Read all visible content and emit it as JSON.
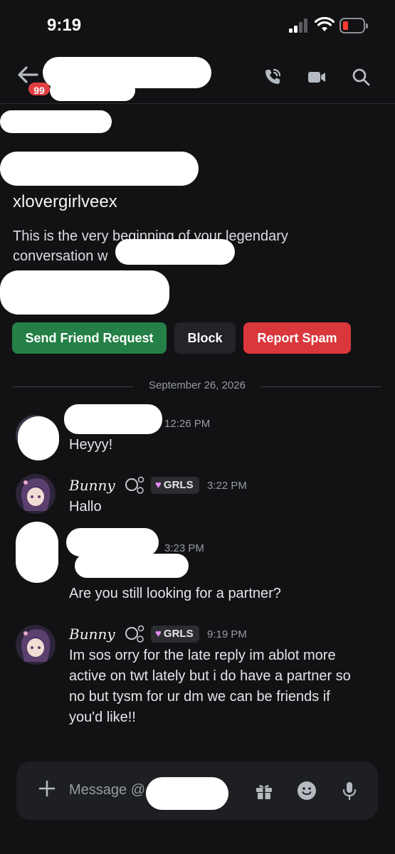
{
  "status_bar": {
    "time": "9:19",
    "battery_color": "#ff3b30"
  },
  "header": {
    "unread_badge": "99",
    "icons": [
      "back-arrow-icon",
      "phone-call-icon",
      "video-camera-icon",
      "search-icon"
    ]
  },
  "profile": {
    "username": "xlovergirlveex",
    "intro_line1": "This is the very beginning of your legendary",
    "intro_line2": "conversation w"
  },
  "actions": {
    "send_friend_request": "Send Friend Request",
    "block": "Block",
    "report_spam": "Report Spam"
  },
  "date_divider": "September 26, 2026",
  "messages": [
    {
      "author": "",
      "time": "12:26 PM",
      "lines": [
        "Heyyy!"
      ]
    },
    {
      "author": "Bunny",
      "tag": "GRLS",
      "time": "3:22 PM",
      "lines": [
        "Hallo"
      ]
    },
    {
      "author": "",
      "time": "3:23 PM",
      "lines": [
        "Are you still looking for a partner?"
      ]
    },
    {
      "author": "Bunny",
      "tag": "GRLS",
      "time": "9:19 PM",
      "lines": [
        "Im sos orry for the late reply im ablot more",
        "active on twt lately but i do have a partner so",
        "no but tysm for ur dm we can be friends if",
        "you'd like!!"
      ]
    }
  ],
  "composer": {
    "placeholder": "Message @",
    "icons": [
      "plus-icon",
      "gift-icon",
      "emoji-icon",
      "microphone-icon"
    ]
  },
  "colors": {
    "background": "#121214",
    "green": "#248046",
    "red": "#da373c",
    "badge": "#e23d43",
    "tag_heart": "#e58af5"
  }
}
